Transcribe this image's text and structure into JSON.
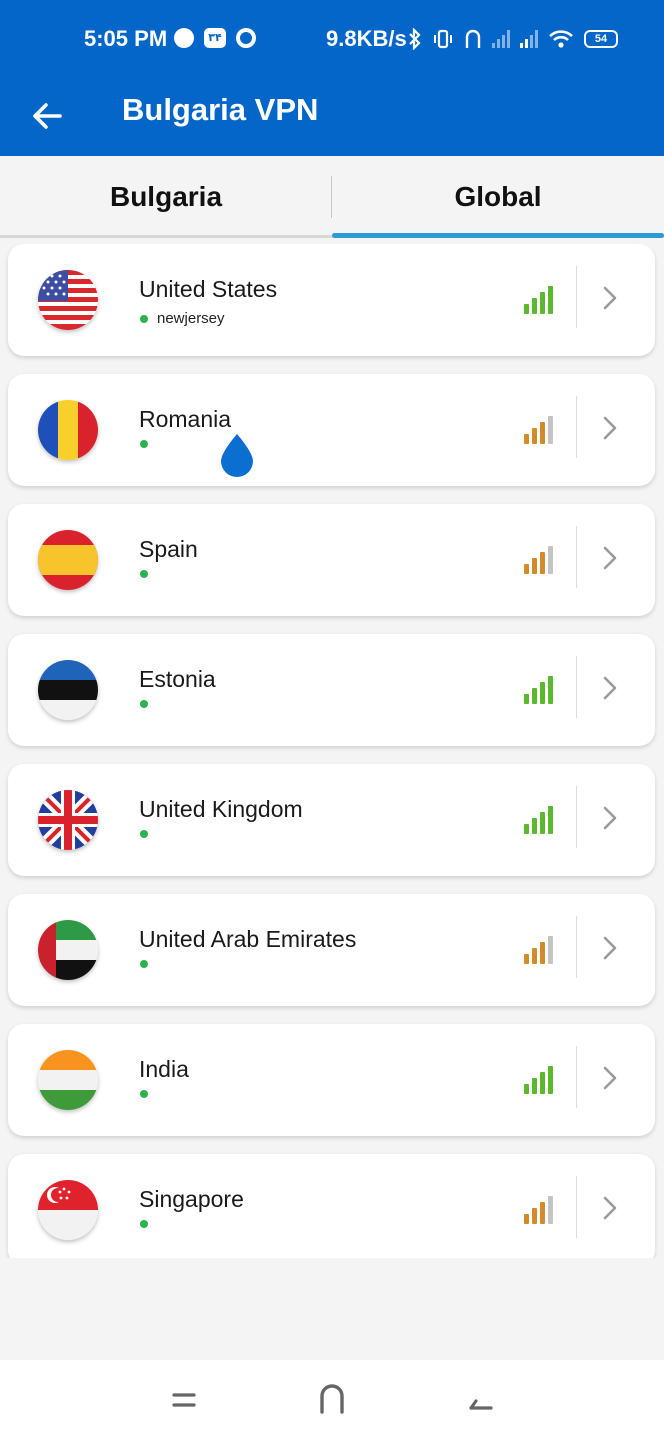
{
  "status_bar": {
    "time": "5:05 PM",
    "badge": "۳۴",
    "speed": "9.8KB/s",
    "battery": "54",
    "icons": [
      "dot-icon",
      "badge-icon",
      "ring-icon",
      "bluetooth-icon",
      "vibrate-icon",
      "hotspot-icon",
      "signal-icon",
      "signal-icon",
      "wifi-icon",
      "battery-icon"
    ]
  },
  "app_bar": {
    "title": "Bulgaria VPN",
    "back_icon": "arrow-left-icon"
  },
  "tabs": [
    {
      "label": "Bulgaria",
      "selected": false
    },
    {
      "label": "Global",
      "selected": true
    }
  ],
  "colors": {
    "primary": "#0566c9",
    "tab_indicator": "#2a9bd8",
    "signal_good": "#5cb82c",
    "signal_medium": "#d58a2a",
    "online_dot": "#2bb24c"
  },
  "servers": [
    {
      "country": "United States",
      "location": "newjersey",
      "flag": "us",
      "signal": "good"
    },
    {
      "country": "Romania",
      "location": "",
      "flag": "ro",
      "signal": "medium"
    },
    {
      "country": "Spain",
      "location": "",
      "flag": "es",
      "signal": "medium"
    },
    {
      "country": "Estonia",
      "location": "",
      "flag": "ee",
      "signal": "good"
    },
    {
      "country": "United Kingdom",
      "location": "",
      "flag": "gb",
      "signal": "good"
    },
    {
      "country": "United Arab Emirates",
      "location": "",
      "flag": "ae",
      "signal": "medium"
    },
    {
      "country": "India",
      "location": "",
      "flag": "in",
      "signal": "good"
    },
    {
      "country": "Singapore",
      "location": "",
      "flag": "sg",
      "signal": "medium"
    }
  ],
  "nav_bar": {
    "icons": [
      "recent-apps-icon",
      "home-icon",
      "back-icon"
    ]
  }
}
